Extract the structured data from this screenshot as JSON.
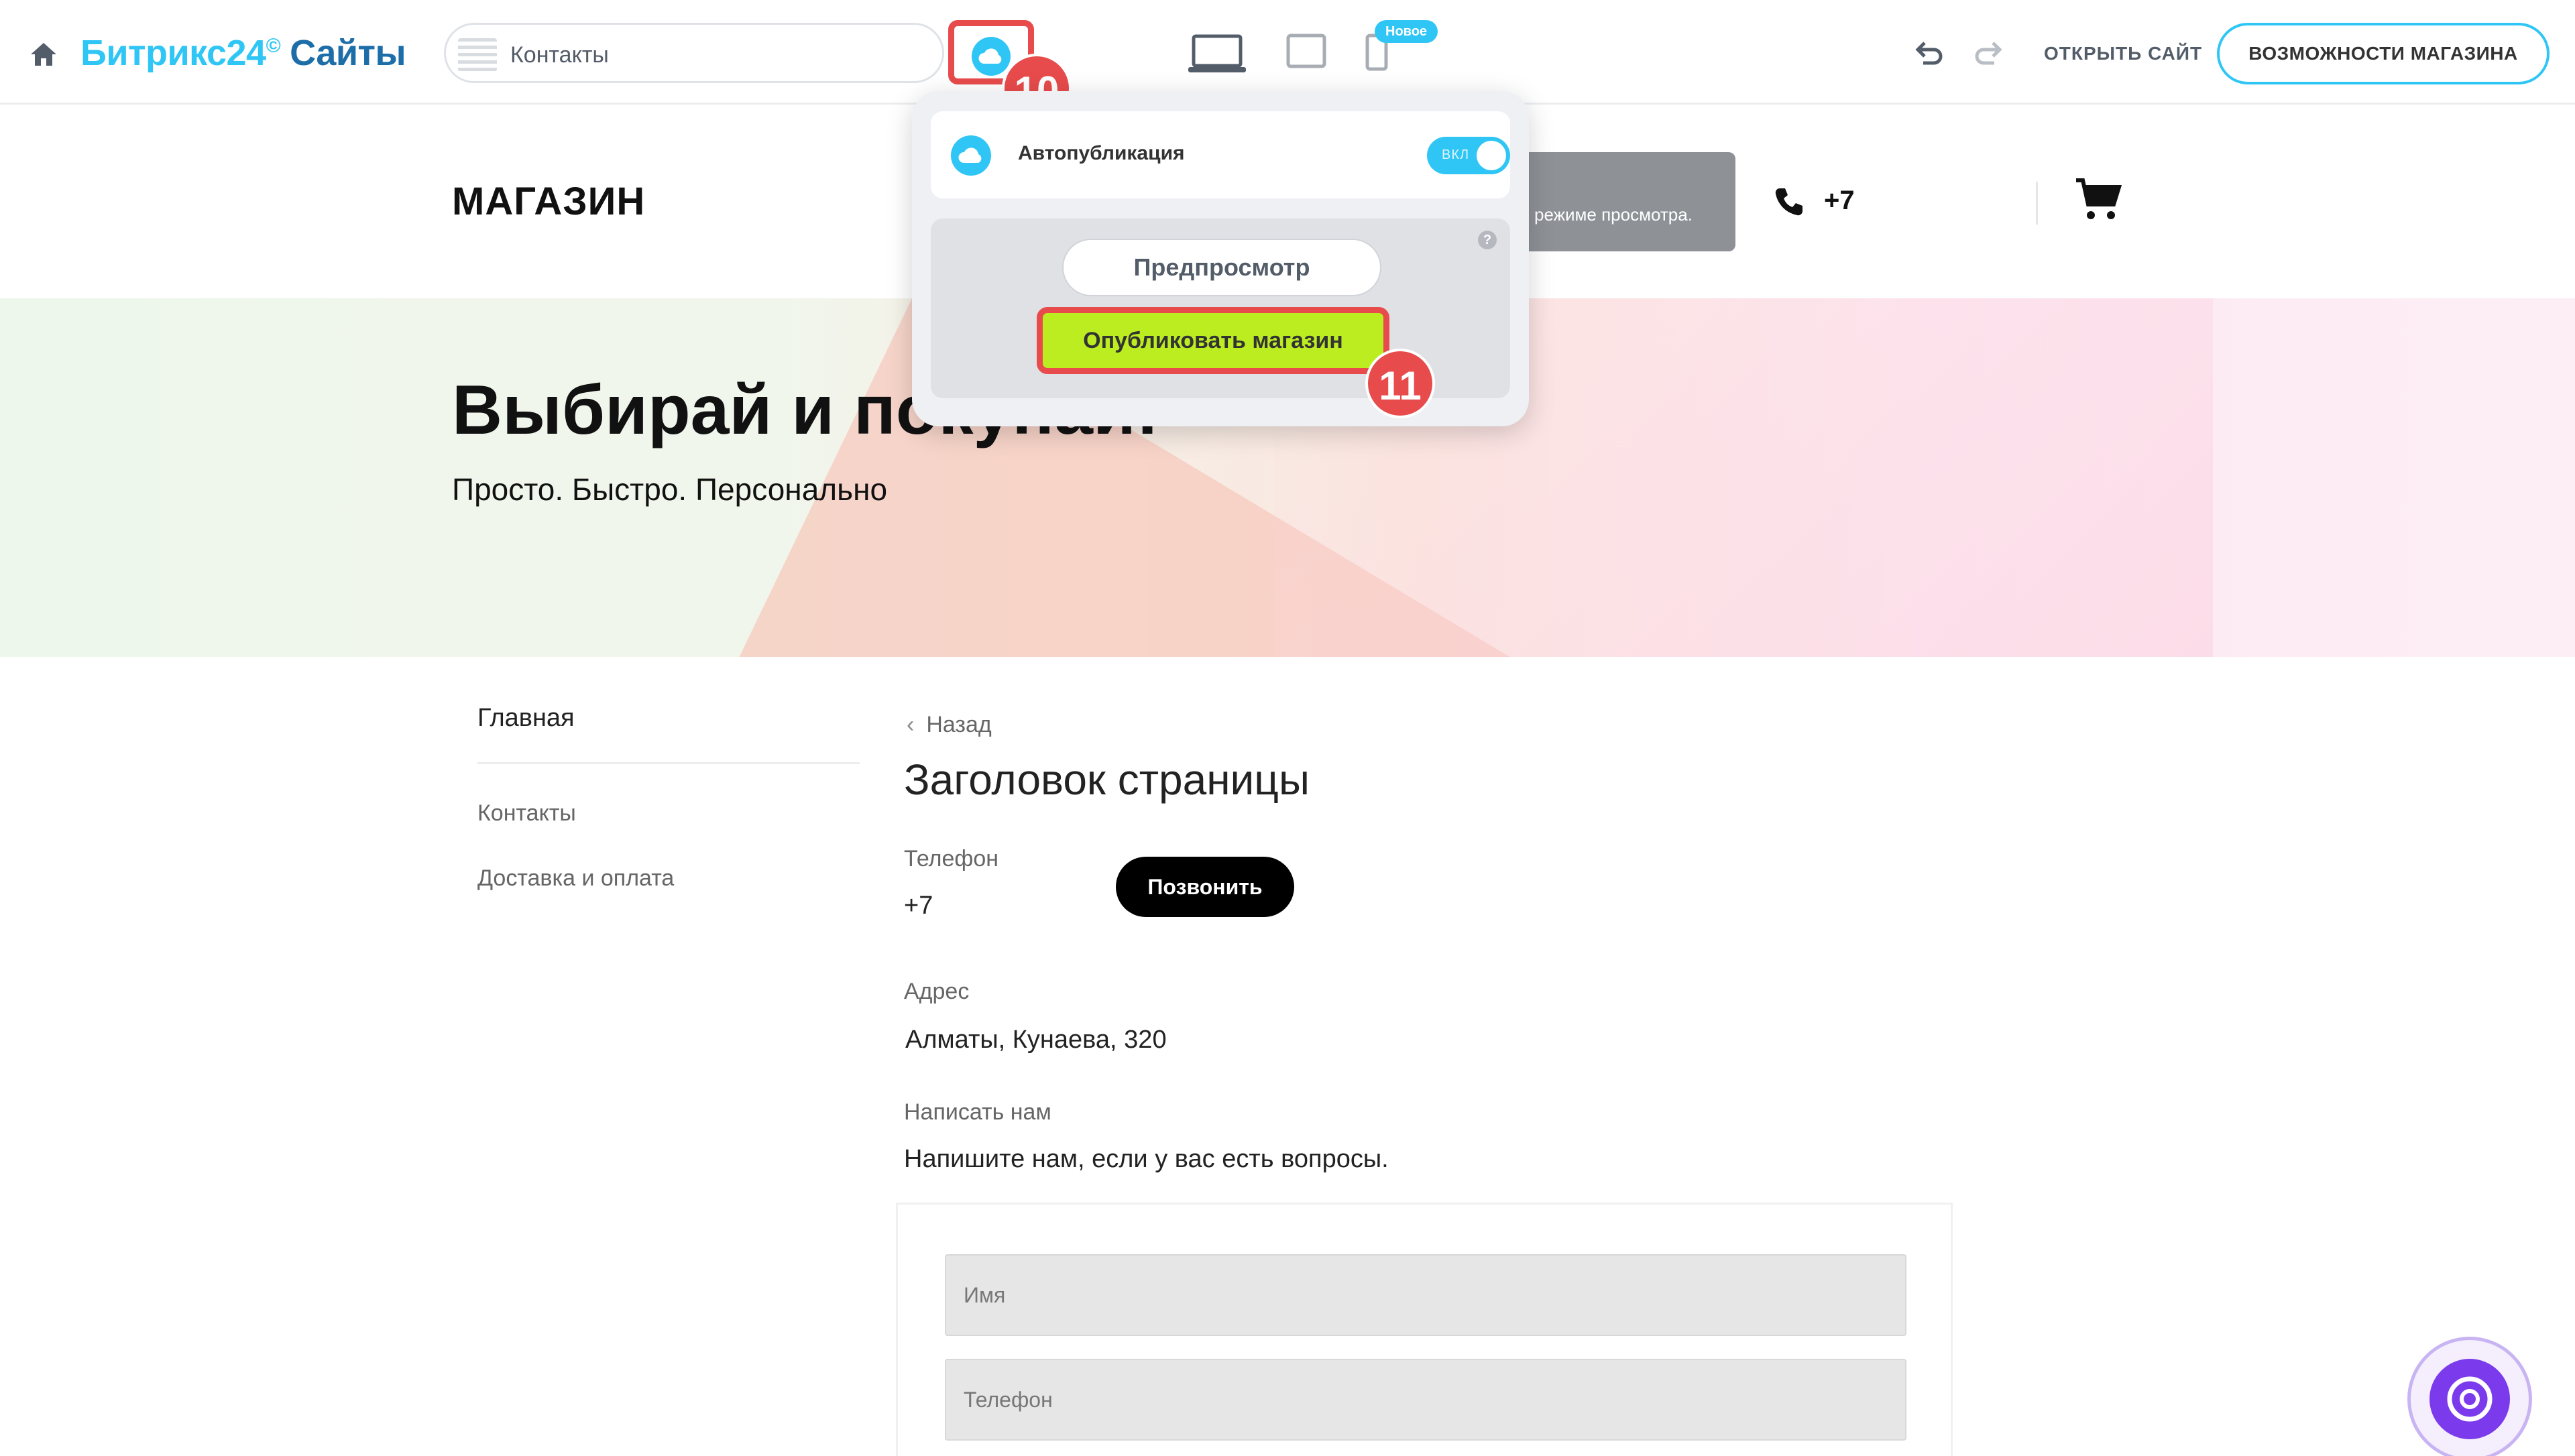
{
  "topbar": {
    "logo_part1": "Битрикс24",
    "logo_clock": "©",
    "logo_part2": "Сайты",
    "page_selector": "Контакты",
    "new_badge": "Новое",
    "open_site": "ОТКРЫТЬ САЙТ",
    "shop_features": "ВОЗМОЖНОСТИ МАГАЗИНА"
  },
  "popup": {
    "autopublish_label": "Автопубликация",
    "toggle_state": "ВКЛ",
    "preview_button": "Предпросмотр",
    "publish_button": "Опубликовать магазин",
    "help": "?"
  },
  "annotations": {
    "step_10": "10",
    "step_11": "11"
  },
  "site_header": {
    "shop_name": "МАГАЗИН",
    "tooltip": "режиме просмотра.",
    "phone": "+7"
  },
  "hero": {
    "title": "Выбирай и покупай!",
    "subtitle": "Просто. Быстро. Персонально"
  },
  "side_menu": {
    "main": "Главная",
    "items": [
      "Контакты",
      "Доставка и оплата"
    ]
  },
  "content": {
    "back": "Назад",
    "title": "Заголовок страницы",
    "phone_label": "Телефон",
    "phone_value": "+7",
    "call_button": "Позвонить",
    "address_label": "Адрес",
    "address_value": "Алматы, Кунаева, 320",
    "write_label": "Написать нам",
    "write_value": "Напишите нам, если у вас есть вопросы."
  },
  "form": {
    "name_placeholder": "Имя",
    "phone_placeholder": "Телефон"
  },
  "colors": {
    "accent": "#2fc6f6",
    "annotation": "#e84b4b",
    "publish": "#bbed21",
    "assistant": "#7c3aed"
  },
  "icons": [
    "home-icon",
    "cloud-icon",
    "laptop-icon",
    "tablet-icon",
    "mobile-icon",
    "undo-icon",
    "redo-icon",
    "phone-icon",
    "cart-icon",
    "chevron-left-icon",
    "assistant-icon"
  ]
}
